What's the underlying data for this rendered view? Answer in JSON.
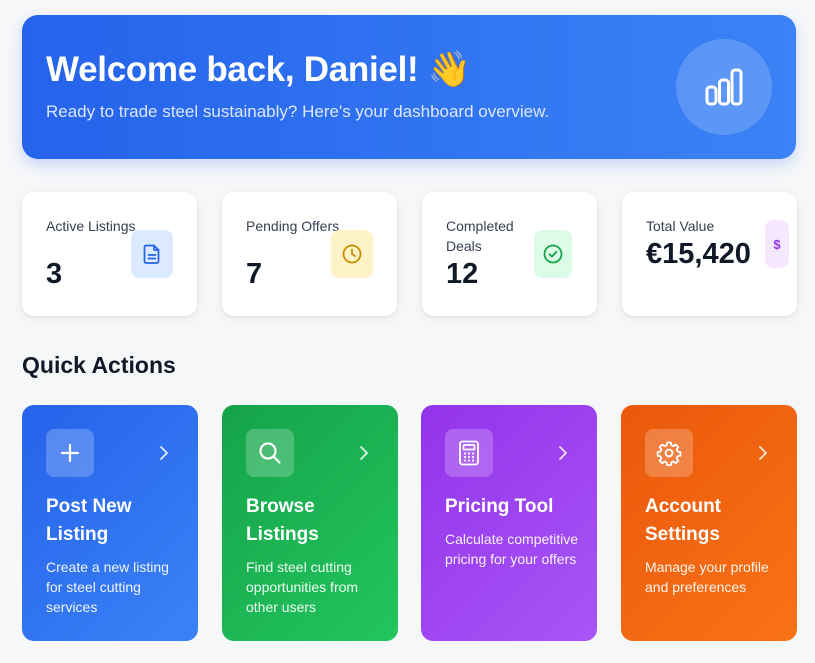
{
  "hero": {
    "title": "Welcome back, Daniel! 👋",
    "subtitle": "Ready to trade steel sustainably? Here's your dashboard overview.",
    "badge_icon": "bar-chart-icon"
  },
  "stats": [
    {
      "label": "Active Listings",
      "value": "3",
      "icon": "document-icon",
      "color": "#2563eb",
      "bg": "#dbeafe"
    },
    {
      "label": "Pending Offers",
      "value": "7",
      "icon": "clock-icon",
      "color": "#ca8a04",
      "bg": "#fef3c7"
    },
    {
      "label": "Completed Deals",
      "value": "12",
      "icon": "check-circle-icon",
      "color": "#16a34a",
      "bg": "#dcfce7"
    },
    {
      "label": "Total Value",
      "value": "€15,420",
      "icon": "dollar-icon",
      "icon_text": "$",
      "color": "#9333ea",
      "bg": "#f3e8ff"
    }
  ],
  "quick_actions": {
    "title": "Quick Actions",
    "items": [
      {
        "title": "Post New Listing",
        "description": "Create a new listing for steel cutting services",
        "icon": "plus-icon",
        "gradient": [
          "#2563eb",
          "#3b82f6"
        ]
      },
      {
        "title": "Browse Listings",
        "description": "Find steel cutting opportunities from other users",
        "icon": "search-icon",
        "gradient": [
          "#16a34a",
          "#22c55e"
        ]
      },
      {
        "title": "Pricing Tool",
        "description": "Calculate competitive pricing for your offers",
        "icon": "calculator-icon",
        "gradient": [
          "#9333ea",
          "#a855f7"
        ]
      },
      {
        "title": "Account Settings",
        "description": "Manage your profile and preferences",
        "icon": "gear-icon",
        "gradient": [
          "#ea580c",
          "#f97316"
        ]
      }
    ]
  }
}
